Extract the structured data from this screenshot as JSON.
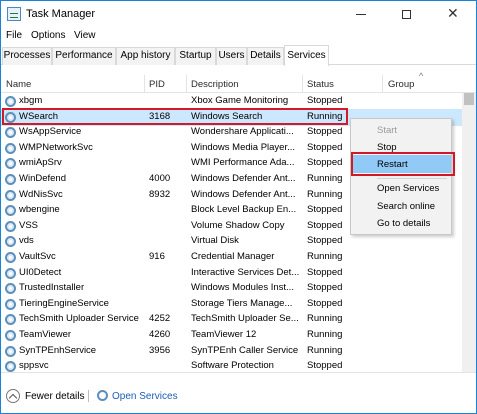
{
  "window": {
    "title": "Task Manager"
  },
  "menubar": {
    "items": [
      "File",
      "Options",
      "View"
    ]
  },
  "tabs": [
    "Processes",
    "Performance",
    "App history",
    "Startup",
    "Users",
    "Details",
    "Services"
  ],
  "active_tab": "Services",
  "columns": {
    "name": "Name",
    "pid": "PID",
    "description": "Description",
    "status": "Status",
    "group": "Group"
  },
  "rows": [
    {
      "name": "xbgm",
      "pid": "",
      "description": "Xbox Game Monitoring",
      "status": "Stopped"
    },
    {
      "name": "WSearch",
      "pid": "3168",
      "description": "Windows Search",
      "status": "Running",
      "selected": true
    },
    {
      "name": "WsAppService",
      "pid": "",
      "description": "Wondershare Applicati...",
      "status": "Stopped"
    },
    {
      "name": "WMPNetworkSvc",
      "pid": "",
      "description": "Windows Media Player...",
      "status": "Stopped"
    },
    {
      "name": "wmiApSrv",
      "pid": "",
      "description": "WMI Performance Ada...",
      "status": "Stopped"
    },
    {
      "name": "WinDefend",
      "pid": "4000",
      "description": "Windows Defender Ant...",
      "status": "Running"
    },
    {
      "name": "WdNisSvc",
      "pid": "8932",
      "description": "Windows Defender Ant...",
      "status": "Running"
    },
    {
      "name": "wbengine",
      "pid": "",
      "description": "Block Level Backup En...",
      "status": "Stopped"
    },
    {
      "name": "VSS",
      "pid": "",
      "description": "Volume Shadow Copy",
      "status": "Stopped"
    },
    {
      "name": "vds",
      "pid": "",
      "description": "Virtual Disk",
      "status": "Stopped"
    },
    {
      "name": "VaultSvc",
      "pid": "916",
      "description": "Credential Manager",
      "status": "Running"
    },
    {
      "name": "UI0Detect",
      "pid": "",
      "description": "Interactive Services Det...",
      "status": "Stopped"
    },
    {
      "name": "TrustedInstaller",
      "pid": "",
      "description": "Windows Modules Inst...",
      "status": "Stopped"
    },
    {
      "name": "TieringEngineService",
      "pid": "",
      "description": "Storage Tiers Manage...",
      "status": "Stopped"
    },
    {
      "name": "TechSmith Uploader Service",
      "pid": "4252",
      "description": "TechSmith Uploader Se...",
      "status": "Running"
    },
    {
      "name": "TeamViewer",
      "pid": "4260",
      "description": "TeamViewer 12",
      "status": "Running"
    },
    {
      "name": "SynTPEnhService",
      "pid": "3956",
      "description": "SynTPEnh Caller Service",
      "status": "Running"
    },
    {
      "name": "sppsvc",
      "pid": "",
      "description": "Software Protection",
      "status": "Stopped"
    }
  ],
  "context_menu": {
    "items": [
      {
        "label": "Start",
        "disabled": true
      },
      {
        "label": "Stop",
        "disabled": false
      },
      {
        "label": "Restart",
        "disabled": false,
        "highlighted": true
      },
      {
        "label": "Open Services",
        "disabled": false
      },
      {
        "label": "Search online",
        "disabled": false
      },
      {
        "label": "Go to details",
        "disabled": false
      }
    ]
  },
  "footer": {
    "fewer_details": "Fewer details",
    "open_services": "Open Services"
  },
  "colors": {
    "accent_border": "#1883d7",
    "selection": "#cce8ff",
    "menu_highlight": "#91c9f7",
    "annotation_red": "#d21a26",
    "link": "#1a5fb4"
  },
  "icons": {
    "app": "task-manager-icon",
    "service": "gear-service-icon"
  }
}
